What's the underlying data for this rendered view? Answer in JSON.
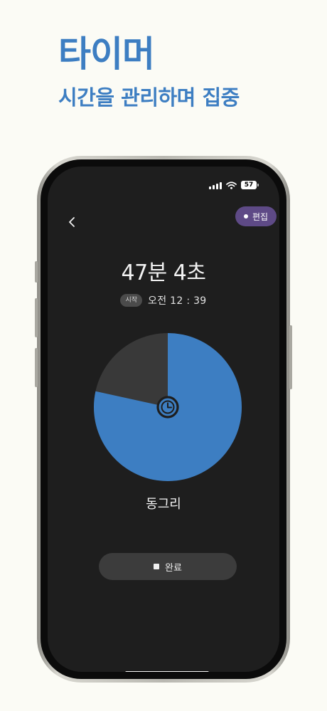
{
  "headline": "타이머",
  "subheadline": "시간을 관리하며 집중",
  "status_bar": {
    "battery": "57"
  },
  "header": {
    "edit_label": "편집"
  },
  "timer": {
    "elapsed": "47분 4초",
    "start_badge": "시작",
    "start_time": "오전 12 : 39",
    "task_name": "동그리",
    "progress_fraction": 0.7844
  },
  "actions": {
    "complete_label": "완료"
  },
  "colors": {
    "headline": "#3d7ec2",
    "pie_fill": "#3d7ec2",
    "pie_track": "#393939",
    "edit_button_bg": "#5e4a86",
    "screen_bg": "#1e1e1e"
  },
  "icons": {
    "back": "chevron-left-icon",
    "clock": "clock-icon",
    "stop": "stop-square-icon",
    "wifi": "wifi-icon",
    "signal": "cellular-signal-icon",
    "battery": "battery-icon"
  }
}
